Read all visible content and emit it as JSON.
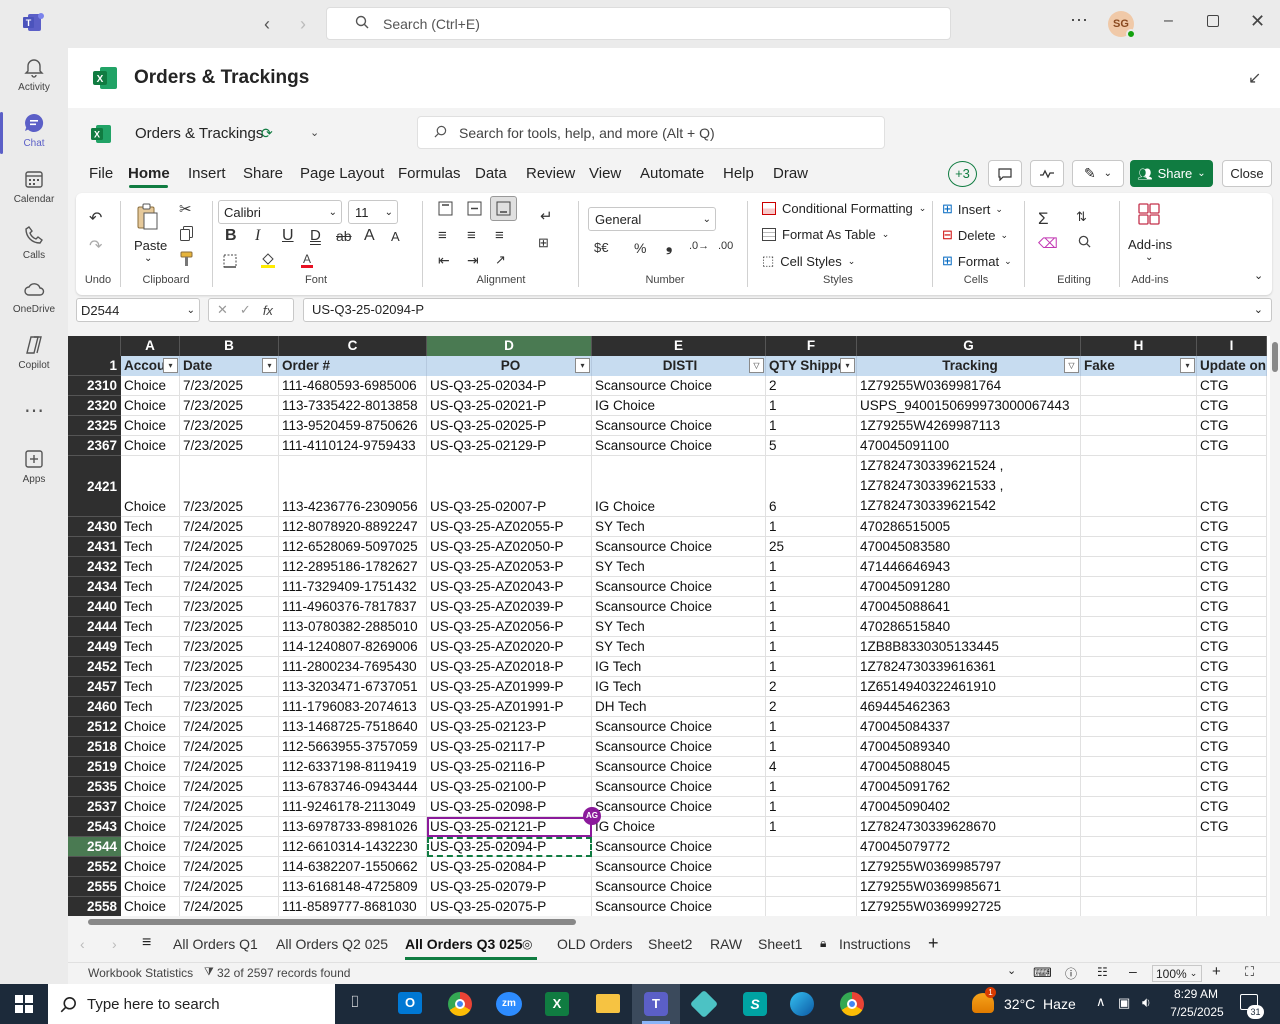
{
  "teams": {
    "search_placeholder": "Search (Ctrl+E)",
    "avatar_initials": "SG",
    "rail": [
      {
        "label": "Activity",
        "icon": "bell-icon"
      },
      {
        "label": "Chat",
        "icon": "chat-icon"
      },
      {
        "label": "Calendar",
        "icon": "calendar-icon"
      },
      {
        "label": "Calls",
        "icon": "phone-icon"
      },
      {
        "label": "OneDrive",
        "icon": "cloud-icon"
      },
      {
        "label": "Copilot",
        "icon": "copilot-icon"
      },
      {
        "label": "",
        "icon": "more-icon"
      },
      {
        "label": "Apps",
        "icon": "apps-icon"
      }
    ],
    "window_title": "Orders & Trackings"
  },
  "excel": {
    "workbook_title": "Orders & Trackings",
    "search_placeholder": "Search for tools, help, and more (Alt + Q)",
    "menu": [
      "File",
      "Home",
      "Insert",
      "Share",
      "Page Layout",
      "Formulas",
      "Data",
      "Review",
      "View",
      "Automate",
      "Help",
      "Draw"
    ],
    "active_menu": "Home",
    "collab_count": "+3",
    "share_label": "Share",
    "close_label": "Close",
    "ribbon": {
      "undo_label": "Undo",
      "paste_label": "Paste",
      "clipboard_label": "Clipboard",
      "font_name": "Calibri",
      "font_size": "11",
      "font_label": "Font",
      "alignment_label": "Alignment",
      "number_format": "General",
      "number_label": "Number",
      "conditional_formatting": "Conditional Formatting",
      "format_as_table": "Format As Table",
      "cell_styles": "Cell Styles",
      "styles_label": "Styles",
      "insert": "Insert",
      "delete": "Delete",
      "format": "Format",
      "cells_label": "Cells",
      "editing_label": "Editing",
      "addins": "Add-ins",
      "addins_label": "Add-ins",
      "currency_symbol": "$€",
      "percent_symbol": "%",
      "comma_symbol": "❟",
      "font_letters": {
        "bold": "B",
        "italic": "I",
        "underline": "U",
        "double_underline": "D",
        "strike": "ab",
        "grow": "A",
        "shrink": "A"
      }
    },
    "name_box": "D2544",
    "formula_fx": "fx",
    "formula_value": "US-Q3-25-02094-P",
    "columns": [
      "A",
      "B",
      "C",
      "D",
      "E",
      "F",
      "G",
      "H",
      "I"
    ],
    "header_row_num": "1",
    "headers": [
      "Accou",
      "Date",
      "Order #",
      "PO",
      "DISTI",
      "QTY Shipped",
      "Tracking",
      "Fake",
      "Update on A"
    ],
    "rows": [
      {
        "num": "2310",
        "cells": [
          "Choice",
          "7/23/2025",
          "111-4680593-6985006",
          "US-Q3-25-02034-P",
          "Scansource Choice",
          "2",
          "1Z79255W0369981764",
          "",
          "CTG"
        ]
      },
      {
        "num": "2320",
        "cells": [
          "Choice",
          "7/23/2025",
          "113-7335422-8013858",
          "US-Q3-25-02021-P",
          "IG Choice",
          "1",
          "USPS_9400150699973000067443",
          "",
          "CTG"
        ]
      },
      {
        "num": "2325",
        "cells": [
          "Choice",
          "7/23/2025",
          "113-9520459-8750626",
          "US-Q3-25-02025-P",
          "Scansource Choice",
          "1",
          "1Z79255W4269987113",
          "",
          "CTG"
        ]
      },
      {
        "num": "2367",
        "cells": [
          "Choice",
          "7/23/2025",
          "111-4110124-9759433",
          "US-Q3-25-02129-P",
          "Scansource Choice",
          "5",
          "470045091100",
          "",
          "CTG"
        ]
      },
      {
        "num": "2421",
        "tall": true,
        "tracking_lines": [
          "1Z7824730339621524 ,",
          "1Z7824730339621533 ,",
          "1Z7824730339621542"
        ],
        "cells": [
          "Choice",
          "7/23/2025",
          "113-4236776-2309056",
          "US-Q3-25-02007-P",
          "IG Choice",
          "6",
          "",
          "",
          "CTG"
        ]
      },
      {
        "num": "2430",
        "cells": [
          "Tech",
          "7/24/2025",
          "112-8078920-8892247",
          "US-Q3-25-AZ02055-P",
          "SY Tech",
          "1",
          "470286515005",
          "",
          "CTG"
        ]
      },
      {
        "num": "2431",
        "cells": [
          "Tech",
          "7/24/2025",
          "112-6528069-5097025",
          "US-Q3-25-AZ02050-P",
          "Scansource Choice",
          "25",
          "470045083580",
          "",
          "CTG"
        ]
      },
      {
        "num": "2432",
        "cells": [
          "Tech",
          "7/24/2025",
          "112-2895186-1782627",
          "US-Q3-25-AZ02053-P",
          "SY Tech",
          "1",
          "471446646943",
          "",
          "CTG"
        ]
      },
      {
        "num": "2434",
        "cells": [
          "Tech",
          "7/24/2025",
          "111-7329409-1751432",
          "US-Q3-25-AZ02043-P",
          "Scansource Choice",
          "1",
          "470045091280",
          "",
          "CTG"
        ]
      },
      {
        "num": "2440",
        "cells": [
          "Tech",
          "7/23/2025",
          "111-4960376-7817837",
          "US-Q3-25-AZ02039-P",
          "Scansource Choice",
          "1",
          "470045088641",
          "",
          "CTG"
        ]
      },
      {
        "num": "2444",
        "cells": [
          "Tech",
          "7/23/2025",
          "113-0780382-2885010",
          "US-Q3-25-AZ02056-P",
          "SY Tech",
          "1",
          "470286515840",
          "",
          "CTG"
        ]
      },
      {
        "num": "2449",
        "cells": [
          "Tech",
          "7/23/2025",
          "114-1240807-8269006",
          "US-Q3-25-AZ02020-P",
          "SY Tech",
          "1",
          "1ZB8B8330305133445",
          "",
          "CTG"
        ]
      },
      {
        "num": "2452",
        "cells": [
          "Tech",
          "7/23/2025",
          "111-2800234-7695430",
          "US-Q3-25-AZ02018-P",
          "IG Tech",
          "1",
          "1Z7824730339616361",
          "",
          "CTG"
        ]
      },
      {
        "num": "2457",
        "cells": [
          "Tech",
          "7/23/2025",
          "113-3203471-6737051",
          "US-Q3-25-AZ01999-P",
          "IG Tech",
          "2",
          "1Z6514940322461910",
          "",
          "CTG"
        ]
      },
      {
        "num": "2460",
        "cells": [
          "Tech",
          "7/23/2025",
          "111-1796083-2074613",
          "US-Q3-25-AZ01991-P",
          "DH Tech",
          "2",
          "469445462363",
          "",
          "CTG"
        ]
      },
      {
        "num": "2512",
        "cells": [
          "Choice",
          "7/24/2025",
          "113-1468725-7518640",
          "US-Q3-25-02123-P",
          "Scansource Choice",
          "1",
          "470045084337",
          "",
          "CTG"
        ]
      },
      {
        "num": "2518",
        "cells": [
          "Choice",
          "7/24/2025",
          "112-5663955-3757059",
          "US-Q3-25-02117-P",
          "Scansource Choice",
          "1",
          "470045089340",
          "",
          "CTG"
        ]
      },
      {
        "num": "2519",
        "cells": [
          "Choice",
          "7/24/2025",
          "112-6337198-8119419",
          "US-Q3-25-02116-P",
          "Scansource Choice",
          "4",
          "470045088045",
          "",
          "CTG"
        ]
      },
      {
        "num": "2535",
        "cells": [
          "Choice",
          "7/24/2025",
          "113-6783746-0943444",
          "US-Q3-25-02100-P",
          "Scansource Choice",
          "1",
          "470045091762",
          "",
          "CTG"
        ]
      },
      {
        "num": "2537",
        "cells": [
          "Choice",
          "7/24/2025",
          "111-9246178-2113049",
          "US-Q3-25-02098-P",
          "Scansource Choice",
          "1",
          "470045090402",
          "",
          "CTG"
        ]
      },
      {
        "num": "2543",
        "cells": [
          "Choice",
          "7/24/2025",
          "113-6978733-8981026",
          "US-Q3-25-02121-P",
          "IG Choice",
          "1",
          "1Z7824730339628670",
          "",
          "CTG"
        ]
      },
      {
        "num": "2544",
        "selected": true,
        "cells": [
          "Choice",
          "7/24/2025",
          "112-6610314-1432230",
          "US-Q3-25-02094-P",
          "Scansource Choice",
          "",
          "470045079772",
          "",
          ""
        ]
      },
      {
        "num": "2552",
        "cells": [
          "Choice",
          "7/24/2025",
          "114-6382207-1550662",
          "US-Q3-25-02084-P",
          "Scansource Choice",
          "",
          "1Z79255W0369985797",
          "",
          ""
        ]
      },
      {
        "num": "2555",
        "cells": [
          "Choice",
          "7/24/2025",
          "113-6168148-4725809",
          "US-Q3-25-02079-P",
          "Scansource Choice",
          "",
          "1Z79255W0369985671",
          "",
          ""
        ]
      },
      {
        "num": "2558",
        "cells": [
          "Choice",
          "7/24/2025",
          "111-8589777-8681030",
          "US-Q3-25-02075-P",
          "Scansource Choice",
          "",
          "1Z79255W0369992725",
          "",
          ""
        ]
      }
    ],
    "presence_badge": "AG",
    "sheet_tabs": [
      "All Orders Q1",
      "All Orders Q2 025",
      "All Orders Q3 025",
      "OLD Orders",
      "Sheet2",
      "RAW",
      "Sheet1",
      "Instructions"
    ],
    "active_tab": "All Orders Q3 025",
    "status_left": "Workbook Statistics",
    "status_filter": "32 of 2597 records found",
    "zoom": "100%"
  },
  "taskbar": {
    "search_placeholder": "Type here to search",
    "weather": "32°C  Haze",
    "weather_badge": "1",
    "time": "8:29 AM",
    "date": "7/25/2025",
    "notif_count": "31",
    "apps": [
      "task-view-icon",
      "outlook-icon",
      "chrome-icon",
      "zoom-icon",
      "excel-icon",
      "file-explorer-icon",
      "teams-icon",
      "app-icon",
      "app2-icon",
      "edge-icon",
      "chrome2-icon"
    ]
  },
  "colors": {
    "accent_green": "#107c41",
    "teams_purple": "#5b5fc7",
    "header_blue": "#c7dcf0",
    "presence_purple": "#8b1a9b"
  }
}
